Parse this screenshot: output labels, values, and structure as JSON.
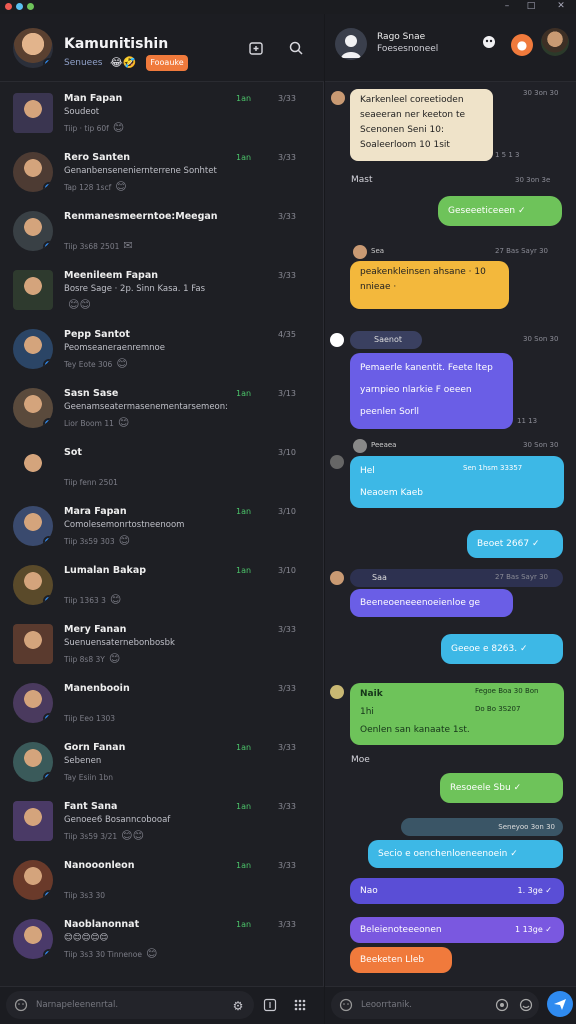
{
  "window": {
    "close": "×",
    "minimize": "–",
    "maximize": "□",
    "controls_close": "✕"
  },
  "left": {
    "header": {
      "name": "Kamunitishin",
      "subtitle": "Senuees",
      "emoji": "😂🤣",
      "badge": "Fooauke"
    },
    "search_placeholder": "Narnapeleenenrtal.",
    "chats": [
      {
        "name": "Man Fapan",
        "preview": "Soudeot",
        "meta": "Tiip · tip 60f",
        "emoji": "😊",
        "count": "1an",
        "time": "3/33",
        "color": "#3a3550"
      },
      {
        "name": "Rero Santen",
        "preview": "Genanbenseneniernterrene Sonhtet",
        "meta": "Tap 128 1scf",
        "emoji": "😊",
        "count": "1an",
        "time": "3/33",
        "color": "#4d3b33"
      },
      {
        "name": "Renmanesmeerntoe:Meegan",
        "preview": "",
        "meta": "Tiip 3s68 2501",
        "emoji": "✉",
        "count": "",
        "time": "3/33",
        "color": "#394045"
      },
      {
        "name": "Meenileem Fapan",
        "preview": "Bosre Sage · 2p. Sinn Kasa. 1 Fas",
        "meta": "",
        "emoji": "😊😊",
        "count": "",
        "time": "3/33",
        "color": "#2e3a2e"
      },
      {
        "name": "Pepp Santot",
        "preview": "Peomseaneraenremnoe",
        "meta": "Tey Eote 306",
        "emoji": "😊",
        "count": "",
        "time": "4/35",
        "color": "#2b4566"
      },
      {
        "name": "Sasn Sase",
        "preview": "Geenamseatermasenementarsemeon:",
        "meta": "Lior Boom 11",
        "emoji": "😊",
        "count": "1an",
        "time": "3/13",
        "color": "#5a4a3c"
      },
      {
        "name": "Sot",
        "preview": "",
        "meta": "Tiip fenn 2501",
        "emoji": "",
        "count": "",
        "time": "3/10",
        "color": "#1e1f24"
      },
      {
        "name": "Mara Fapan",
        "preview": "Comolesemonrtostneenoom",
        "meta": "Tiip 3s59 303",
        "emoji": "😊",
        "count": "1an",
        "time": "3/10",
        "color": "#3a4a6e"
      },
      {
        "name": "Lumalan Bakap",
        "preview": "",
        "meta": "Tiip 1363 3",
        "emoji": "😊",
        "count": "1an",
        "time": "3/10",
        "color": "#5a4a2a"
      },
      {
        "name": "Mery Fanan",
        "preview": "Suenuensaternebonbosbk",
        "meta": "Tiip 8s8 3Y",
        "emoji": "😊",
        "count": "",
        "time": "3/33",
        "color": "#5a3a2e"
      },
      {
        "name": "Manenbooin",
        "preview": "",
        "meta": "Tiip Eeo 1303",
        "emoji": "",
        "count": "",
        "time": "3/33",
        "color": "#4a3a5e"
      },
      {
        "name": "Gorn Fanan",
        "preview": "Sebenen",
        "meta": "Tay Esiin 1bn",
        "emoji": "",
        "count": "1an",
        "time": "3/33",
        "color": "#3a5a5a"
      },
      {
        "name": "Fant Sana",
        "preview": "Genoee6 Bosanncobooaf",
        "meta": "Tiip 3s59 3/21",
        "emoji": "😊😊",
        "count": "1an",
        "time": "3/33",
        "color": "#4a3a66"
      },
      {
        "name": "Nanooonleon",
        "preview": "",
        "meta": "Tiip 3s3 30",
        "emoji": "",
        "count": "1an",
        "time": "3/33",
        "color": "#6a3a2a"
      },
      {
        "name": "Naoblanonnat",
        "preview": "😊😊😊😊😊",
        "meta": "Tiip 3s3 30  Tinnenoe",
        "emoji": "😊",
        "count": "1an",
        "time": "3/33",
        "color": "#4a3a6a"
      }
    ]
  },
  "right": {
    "header": {
      "name": "Rago Snae",
      "status": "Foesesnoneel"
    },
    "messages": {
      "m1": "Karkenleel coreetioden seaeeran ner keeton te Scenonen Seni 10: Soaleerloom 10 1sit",
      "m1_time": "30 3on 30",
      "m1_sub": "1 5 1 3",
      "day1": "Mast",
      "day1_time": "30 3on 3e",
      "m2": "Geseeeticeeen",
      "m3_name": "Sea",
      "m3_time": "27 Bas Sayr 30",
      "m3": "peakenkleinsen ahsane · 10 nnieae ·",
      "m4_name": "Saenot",
      "m4_time": "30 Son 30",
      "m4": "Pemaerle kanentit. Feete ltep yarnpieo nlarkie F oeeen peenlen Sorll",
      "m4_sub": "11 13",
      "m5_name": "Peeaea",
      "m5_time": "30 Son 30",
      "m5_a": "Hel",
      "m5_a_time": "Sen 1hsm 33357",
      "m5_b": "Neaoem Kaeb",
      "m6": "Beoet 2667",
      "m7_name": "Saa",
      "m7_time": "27 Bas Sayr 30",
      "m7": "Beeneoeneeenoeienloe ge",
      "m8": "Geeoe e 8263.",
      "m9_name": "Naik",
      "m9_meta": "Fegoe Boa 30 Bon",
      "m9_a": "1hi",
      "m9_a_meta": "Do Bo 3S207",
      "m9_b": "Oenlen san kanaate 1st.",
      "day2": "Moe",
      "m10": "Resoeele Sbu",
      "m11_meta": "Seneyoo 3on 30",
      "m12": "Secio e oenchenloeneenoein",
      "m13": "Nao",
      "m13_time": "1. 3ge",
      "m14": "Beleienoteeeonen",
      "m14_time": "1 13ge",
      "m15": "Beeketen Lleb"
    },
    "input_placeholder": "Leoorrtanik.",
    "check": "✓"
  },
  "colors": {
    "green": "#6ec35a",
    "yellow": "#f3b83c",
    "purple": "#6a5ee6",
    "cyan": "#3db8e6",
    "cream": "#efe3c9",
    "orange": "#f07a3c"
  }
}
